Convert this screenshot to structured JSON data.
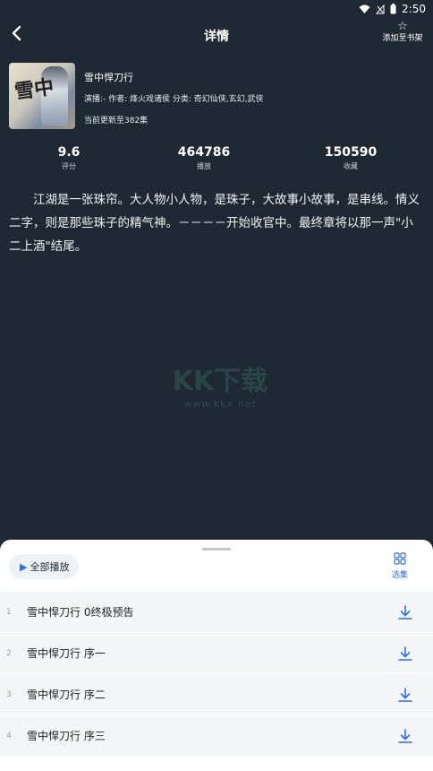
{
  "status_bar": {
    "time": "2:50"
  },
  "header": {
    "title": "详情",
    "add_to_shelf": "添加至书架"
  },
  "book": {
    "title": "雪中悍刀行",
    "meta": "演播:-  作者: 烽火戏诸侯  分类: 奇幻仙侠,玄幻,武侠",
    "updated": "当前更新至382集",
    "cover_text": "雪中"
  },
  "stats": [
    {
      "value": "9.6",
      "label": "评分"
    },
    {
      "value": "464786",
      "label": "播放"
    },
    {
      "value": "150590",
      "label": "收藏"
    }
  ],
  "description": "江湖是一张珠帘。大人物小人物，是珠子，大故事小故事，是串线。情义二字，则是那些珠子的精气神。－－－－开始收官中。最终章将以那一声\"小二上酒\"结尾。",
  "watermark": {
    "logo": "KK下载",
    "url": "www.kkx.net"
  },
  "sheet": {
    "play_all": "全部播放",
    "select_episodes": "选集",
    "episodes": [
      {
        "index": "1",
        "title": "雪中悍刀行 0终极预告"
      },
      {
        "index": "2",
        "title": "雪中悍刀行 序一"
      },
      {
        "index": "3",
        "title": "雪中悍刀行 序二"
      },
      {
        "index": "4",
        "title": "雪中悍刀行 序三"
      }
    ]
  },
  "colors": {
    "background": "#1e2933",
    "accent": "#2d6fe0",
    "sheet_bg": "#ffffff",
    "row_bg": "#f4f5f7"
  },
  "icons": [
    "back-arrow-icon",
    "star-icon",
    "wifi-icon",
    "signal-icon",
    "battery-icon",
    "play-icon",
    "grid-icon",
    "download-icon"
  ]
}
